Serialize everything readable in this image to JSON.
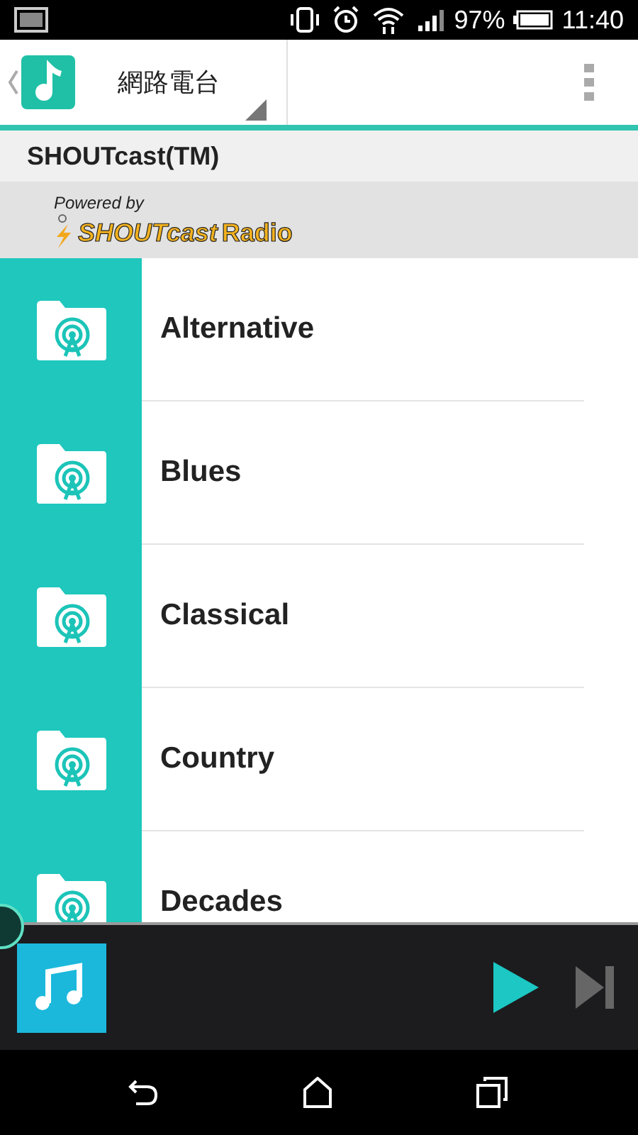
{
  "status_bar": {
    "battery": "97%",
    "time": "11:40"
  },
  "header": {
    "title": "網路電台"
  },
  "section": {
    "title": "SHOUTcast(TM)"
  },
  "banner": {
    "powered_by": "Powered by",
    "logo_name": "SHOUTcast",
    "logo_suffix": "Radio"
  },
  "genres": [
    {
      "label": "Alternative"
    },
    {
      "label": "Blues"
    },
    {
      "label": "Classical"
    },
    {
      "label": "Country"
    },
    {
      "label": "Decades"
    }
  ]
}
